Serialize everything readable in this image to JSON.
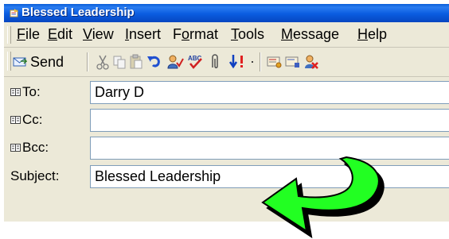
{
  "window": {
    "title": "Blessed Leadership"
  },
  "menu": {
    "items": [
      {
        "key": "F",
        "rest": "ile"
      },
      {
        "key": "E",
        "rest": "dit"
      },
      {
        "key": "V",
        "rest": "iew"
      },
      {
        "key": "I",
        "rest": "nsert"
      },
      {
        "pre": "F",
        "key": "o",
        "rest": "rmat"
      },
      {
        "key": "T",
        "rest": "ools"
      },
      {
        "key": "M",
        "rest": "essage"
      },
      {
        "key": "H",
        "rest": "elp"
      }
    ]
  },
  "toolbar": {
    "send_label": "Send"
  },
  "headers": {
    "to_label": "To:",
    "to_value": "Darry D",
    "cc_label": "Cc:",
    "cc_value": "",
    "bcc_label": "Bcc:",
    "bcc_value": "",
    "subject_label": "Subject:",
    "subject_value": "Blessed Leadership"
  },
  "colors": {
    "title_bar": "#0a5ce0",
    "arrow_fill": "#22ff22",
    "arrow_outline": "#000000"
  }
}
